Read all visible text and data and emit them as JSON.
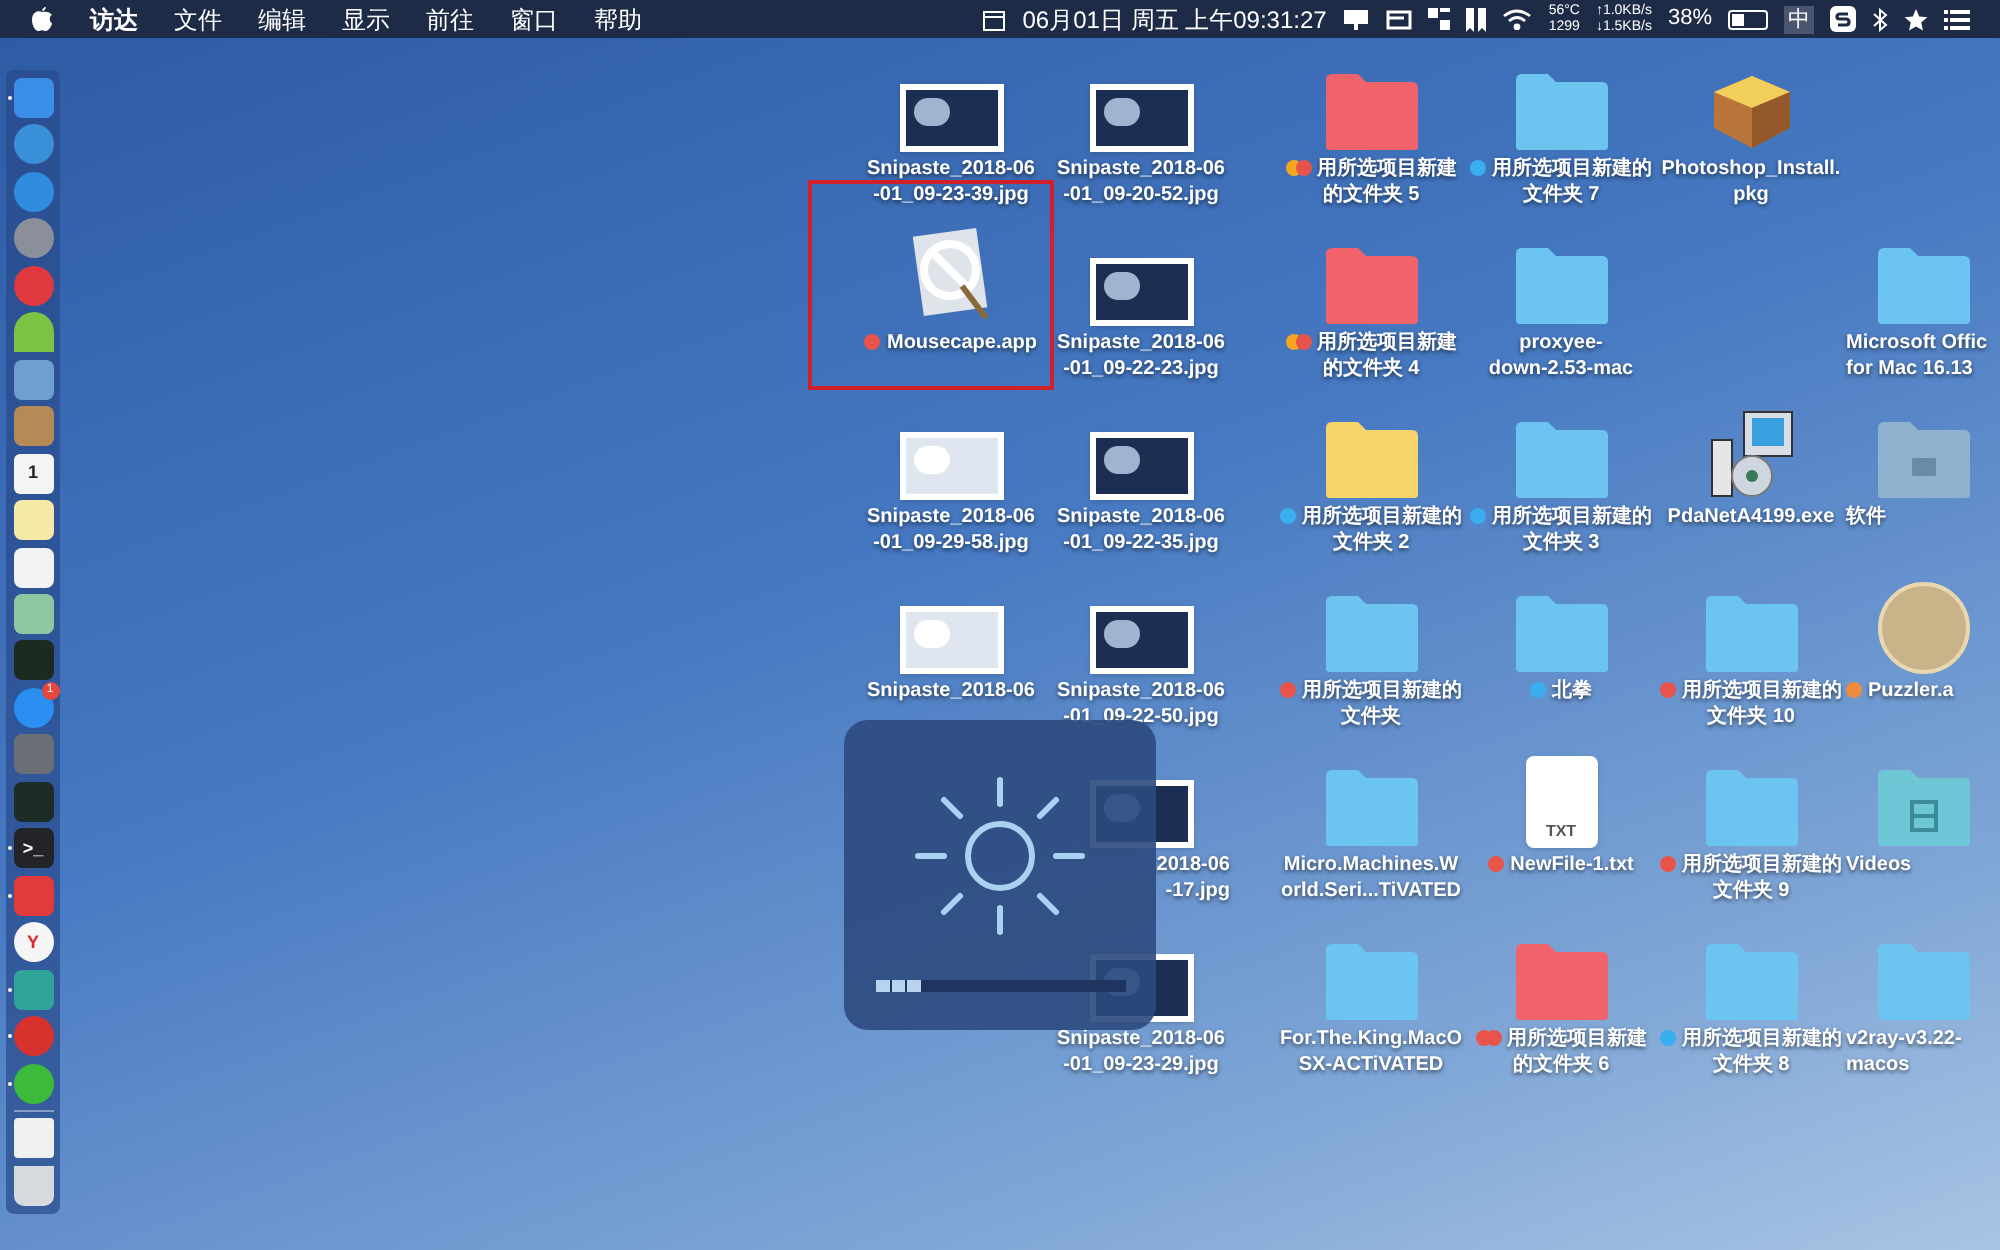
{
  "menu_bar": {
    "menus": [
      {
        "label": "访达",
        "bold": true
      },
      {
        "label": "文件",
        "bold": false
      },
      {
        "label": "编辑",
        "bold": false
      },
      {
        "label": "显示",
        "bold": false
      },
      {
        "label": "前往",
        "bold": false
      },
      {
        "label": "窗口",
        "bold": false
      },
      {
        "label": "帮助",
        "bold": false
      }
    ],
    "clock": "06月01日 周五 上午09:31:27",
    "temperature": "56°C",
    "fan_speed": "1299",
    "upload": "↑1.0KB/s",
    "download": "↓1.5KB/s",
    "battery_percent": "38%",
    "battery": {
      "level": 0.38
    },
    "input_method": "中"
  },
  "dock": {
    "items": [
      {
        "kind": "square",
        "color": "#3b8ee8",
        "running": true
      },
      {
        "kind": "round",
        "color": "#3a8fd9",
        "running": false
      },
      {
        "kind": "round",
        "color": "#2f8ce0",
        "running": false
      },
      {
        "kind": "round",
        "color": "#8a8f99",
        "running": false
      },
      {
        "kind": "round",
        "color": "#e0383e",
        "running": false
      },
      {
        "kind": "android",
        "color": "#7cc243",
        "running": false
      },
      {
        "kind": "square",
        "color": "#6f9ed0",
        "running": false
      },
      {
        "kind": "square",
        "color": "#b58a55",
        "running": false
      },
      {
        "kind": "calendar",
        "color": "#f4f4f4",
        "glyph": "1",
        "running": false
      },
      {
        "kind": "square",
        "color": "#f6e9a8",
        "running": false
      },
      {
        "kind": "square",
        "color": "#f2f2f2",
        "running": false
      },
      {
        "kind": "square",
        "color": "#8fc7a0",
        "running": false
      },
      {
        "kind": "square",
        "color": "#1d2a22",
        "running": false
      },
      {
        "kind": "round",
        "color": "#2a8ff0",
        "badge": "1",
        "running": false
      },
      {
        "kind": "square",
        "color": "#6b6f75",
        "running": false
      },
      {
        "kind": "square",
        "color": "#1f2b25",
        "running": false
      },
      {
        "kind": "square",
        "color": "#222428",
        "glyph": ">_",
        "running": true
      },
      {
        "kind": "square",
        "color": "#e33b3b",
        "running": true
      },
      {
        "kind": "round",
        "color": "#f5f5f5",
        "glyph": "Y",
        "running": false
      },
      {
        "kind": "square",
        "color": "#2fa59a",
        "running": true
      },
      {
        "kind": "round",
        "color": "#d8322f",
        "running": true
      },
      {
        "kind": "round",
        "color": "#3cbb3a",
        "running": true
      },
      {
        "kind": "file",
        "color": "#f0f0f0",
        "running": false
      },
      {
        "kind": "trash",
        "color": "#d6d9de",
        "running": false
      }
    ]
  },
  "desktop": {
    "columns": [
      [
        {
          "kind": "screenshot",
          "light": false,
          "lines": [
            "Snipaste_2018-06",
            "-01_09-23-39.jpg"
          ]
        },
        {
          "kind": "app",
          "lines": [
            "Mousecape.app"
          ],
          "tags": [
            {
              "color": "#e8534a"
            }
          ],
          "highlighted": true
        },
        {
          "kind": "screenshot",
          "light": true,
          "lines": [
            "Snipaste_2018-06",
            "-01_09-29-58.jpg"
          ]
        },
        {
          "kind": "screenshot",
          "light": true,
          "lines": [
            "Snipaste_2018-06"
          ]
        }
      ],
      [
        {
          "kind": "screenshot",
          "light": false,
          "lines": [
            "Snipaste_2018-06",
            "-01_09-20-52.jpg"
          ]
        },
        {
          "kind": "screenshot",
          "light": false,
          "lines": [
            "Snipaste_2018-06",
            "-01_09-22-23.jpg"
          ]
        },
        {
          "kind": "screenshot",
          "light": false,
          "lines": [
            "Snipaste_2018-06",
            "-01_09-22-35.jpg"
          ]
        },
        {
          "kind": "screenshot",
          "light": false,
          "lines": [
            "Snipaste_2018-06",
            "-01_09-22-50.jpg"
          ]
        },
        {
          "kind": "covered",
          "lines": [
            "2018-06",
            "-17.jpg"
          ]
        },
        {
          "kind": "screenshot",
          "light": false,
          "lines": [
            "Snipaste_2018-06",
            "-01_09-23-29.jpg"
          ]
        }
      ],
      [
        {
          "kind": "folder",
          "color": "#f0636b",
          "lines": [
            "用所选项目新建",
            "的文件夹 5"
          ],
          "tags": [
            {
              "color": "#f5a623"
            },
            {
              "color": "#e8534a"
            }
          ]
        },
        {
          "kind": "folder",
          "color": "#f0636b",
          "lines": [
            "用所选项目新建",
            "的文件夹 4"
          ],
          "tags": [
            {
              "color": "#f5a623"
            },
            {
              "color": "#e8534a"
            }
          ]
        },
        {
          "kind": "folder",
          "color": "#f8d56b",
          "lines": [
            "用所选项目新建的",
            "文件夹 2"
          ],
          "tags": [
            {
              "color": "#3aaef0"
            }
          ]
        },
        {
          "kind": "folder",
          "color": "#6cc4f0",
          "lines": [
            "用所选项目新建的",
            "文件夹"
          ],
          "tags": [
            {
              "color": "#e8534a"
            }
          ]
        },
        {
          "kind": "folder",
          "color": "#6cc4f0",
          "lines": [
            "Micro.Machines.W",
            "orld.Seri...TiVATED"
          ]
        },
        {
          "kind": "folder",
          "color": "#6cc4f0",
          "lines": [
            "For.The.King.MacO",
            "SX-ACTiVATED"
          ]
        }
      ],
      [
        {
          "kind": "folder",
          "color": "#6cc4f0",
          "lines": [
            "用所选项目新建的",
            "文件夹 7"
          ],
          "tags": [
            {
              "color": "#3aaef0"
            }
          ]
        },
        {
          "kind": "folder",
          "color": "#6cc4f0",
          "lines": [
            "proxyee-",
            "down-2.53-mac"
          ]
        },
        {
          "kind": "folder",
          "color": "#6cc4f0",
          "lines": [
            "用所选项目新建的",
            "文件夹 3"
          ],
          "tags": [
            {
              "color": "#3aaef0"
            }
          ]
        },
        {
          "kind": "folder",
          "color": "#6cc4f0",
          "lines": [
            "北拳"
          ],
          "tags": [
            {
              "color": "#3aaef0"
            }
          ]
        },
        {
          "kind": "textfile",
          "lines": [
            "NewFile-1.txt"
          ],
          "badge": "TXT",
          "tags": [
            {
              "color": "#e8534a"
            }
          ]
        },
        {
          "kind": "folder",
          "color": "#f0636b",
          "lines": [
            "用所选项目新建",
            "的文件夹 6"
          ],
          "tags": [
            {
              "color": "#e8534a"
            },
            {
              "color": "#e8534a"
            }
          ]
        }
      ],
      [
        {
          "kind": "package",
          "lines": [
            "Photoshop_Install.",
            "pkg"
          ]
        },
        {
          "kind": "empty"
        },
        {
          "kind": "installer",
          "lines": [
            "PdaNetA4199.exe"
          ]
        },
        {
          "kind": "folder",
          "color": "#6cc4f0",
          "lines": [
            "用所选项目新建的",
            "文件夹 10"
          ],
          "tags": [
            {
              "color": "#e8534a"
            }
          ]
        },
        {
          "kind": "folder",
          "color": "#6cc4f0",
          "lines": [
            "用所选项目新建的",
            "文件夹 9"
          ],
          "tags": [
            {
              "color": "#e8534a"
            }
          ]
        },
        {
          "kind": "folder",
          "color": "#6cc4f0",
          "lines": [
            "用所选项目新建的",
            "文件夹 8"
          ],
          "tags": [
            {
              "color": "#3aaef0"
            }
          ]
        }
      ],
      [
        {
          "kind": "empty"
        },
        {
          "kind": "folder",
          "color": "#6cc4f0",
          "lines": [
            "Microsoft Offic",
            "for Mac 16.13"
          ]
        },
        {
          "kind": "toolfolder",
          "color": "#8fb3cf",
          "lines": [
            "软件"
          ]
        },
        {
          "kind": "avatar",
          "lines": [
            "Puzzler.a"
          ],
          "tags": [
            {
              "color": "#f08a3c"
            }
          ]
        },
        {
          "kind": "moviefolder",
          "color": "#6fc7d6",
          "lines": [
            "Videos"
          ]
        },
        {
          "kind": "folder",
          "color": "#6cc4f0",
          "lines": [
            "v2ray-v3.22-",
            "macos"
          ]
        }
      ]
    ]
  },
  "brightness_hud": {
    "level": 0.19
  }
}
